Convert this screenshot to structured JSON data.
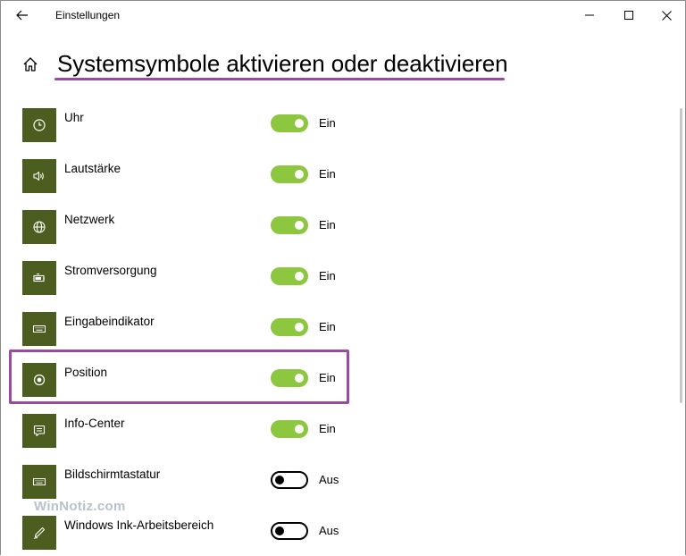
{
  "window": {
    "app_title": "Einstellungen",
    "controls": [
      "minimize-icon",
      "maximize-icon",
      "close-icon"
    ]
  },
  "page": {
    "title": "Systemsymbole aktivieren oder deaktivieren"
  },
  "colors": {
    "tile_bg": "#4b5e1f",
    "toggle_on": "#8dc63f",
    "highlight": "#9b4a9f",
    "watermark": "#b8c2cc"
  },
  "settings": [
    {
      "label": "Uhr",
      "icon": "clock-icon",
      "on": true,
      "state": "Ein"
    },
    {
      "label": "Lautstärke",
      "icon": "volume-icon",
      "on": true,
      "state": "Ein"
    },
    {
      "label": "Netzwerk",
      "icon": "globe-icon",
      "on": true,
      "state": "Ein"
    },
    {
      "label": "Stromversorgung",
      "icon": "battery-icon",
      "on": true,
      "state": "Ein"
    },
    {
      "label": "Eingabeindikator",
      "icon": "keyboard-icon",
      "on": true,
      "state": "Ein"
    },
    {
      "label": "Position",
      "icon": "location-icon",
      "on": true,
      "state": "Ein"
    },
    {
      "label": "Info-Center",
      "icon": "action-center-icon",
      "on": true,
      "state": "Ein"
    },
    {
      "label": "Bildschirmtastatur",
      "icon": "keyboard-icon",
      "on": false,
      "state": "Aus"
    },
    {
      "label": "Windows Ink-Arbeitsbereich",
      "icon": "pen-icon",
      "on": false,
      "state": "Aus"
    }
  ],
  "watermark": "WinNotiz.com"
}
